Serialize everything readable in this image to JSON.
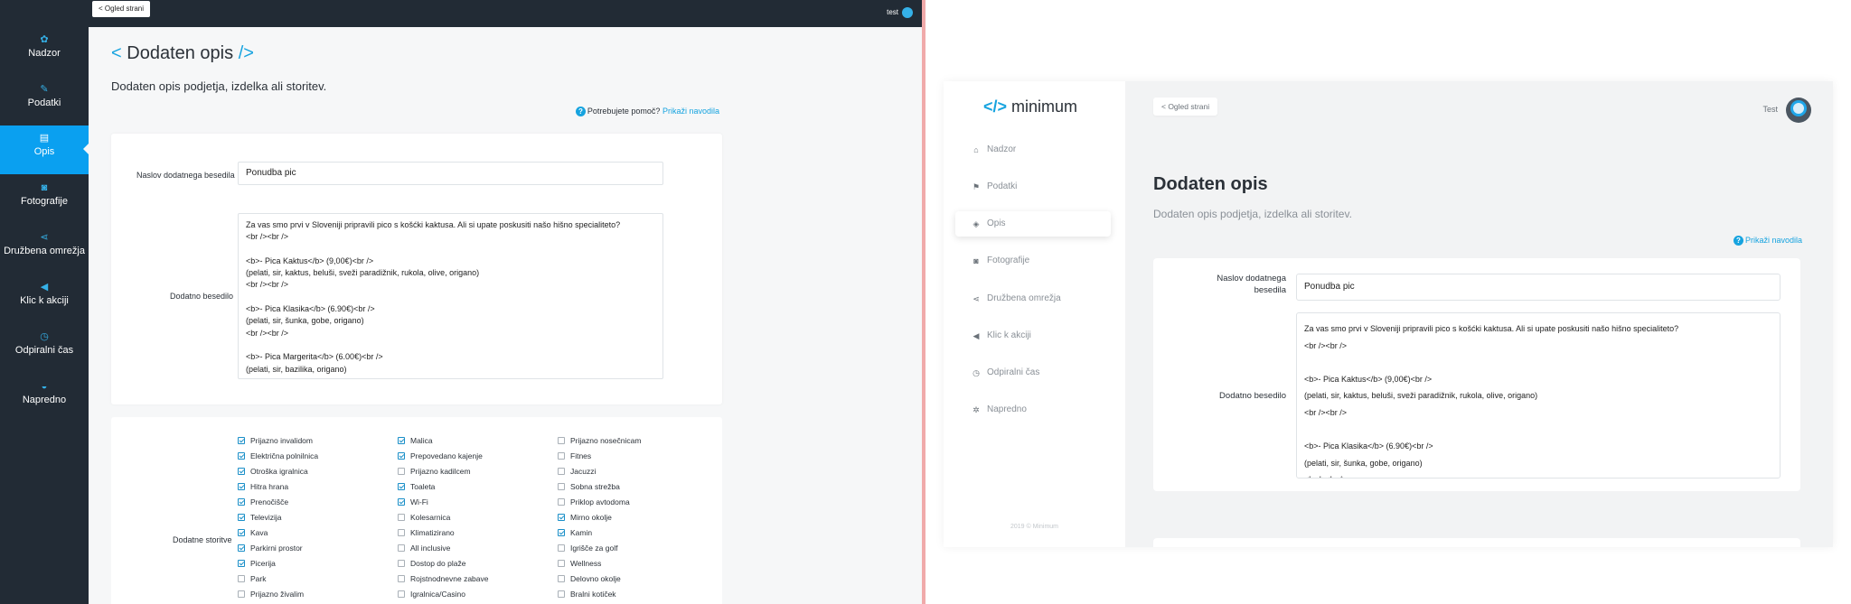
{
  "left": {
    "sidebar": [
      {
        "label": "Nadzor",
        "icon": "palette-icon",
        "glyph": "✿"
      },
      {
        "label": "Podatki",
        "icon": "document-icon",
        "glyph": "✎"
      },
      {
        "label": "Opis",
        "icon": "book-icon",
        "glyph": "▤",
        "active": true
      },
      {
        "label": "Fotografije",
        "icon": "camera-icon",
        "glyph": "◙"
      },
      {
        "label": "Družbena omrežja",
        "icon": "share-icon",
        "glyph": "⋖"
      },
      {
        "label": "Klic k akciji",
        "icon": "megaphone-icon",
        "glyph": "◀"
      },
      {
        "label": "Odpiralni čas",
        "icon": "clock-icon",
        "glyph": "◷"
      },
      {
        "label": "Napredno",
        "icon": "gauge-icon",
        "glyph": "◒"
      }
    ],
    "topbar": {
      "preview_label": "< Ogled strani",
      "user_name": "test"
    },
    "title_open": "<",
    "title": "Dodaten opis",
    "title_close": "/>",
    "subtitle": "Dodaten opis podjetja, izdelka ali storitev.",
    "help_text": "Potrebujete pomoč?",
    "help_link": "Prikaži navodila",
    "form": {
      "title_label": "Naslov dodatnega besedila",
      "title_value": "Ponudba pic",
      "text_label": "Dodatno besedilo",
      "text_value": "Za vas smo prvi v Sloveniji pripravili pico s košćki kaktusa. Ali si upate poskusiti našo hišno specialiteto?\n<br /><br />\n\n<b>- Pica Kaktus</b> (9,00€)<br />\n(pelati, sir, kaktus, beluši, sveži paradižnik, rukola, olive, origano)\n<br /><br />\n\n<b>- Pica Klasika</b> (6.90€)<br />\n(pelati, sir, šunka, gobe, origano)\n<br /><br />\n\n<b>- Pica Margerita</b> (6.00€)<br />\n(pelati, sir, bazilika, origano)"
    },
    "services_label": "Dodatne storitve",
    "services": [
      [
        {
          "label": "Prijazno invalidom",
          "checked": true
        },
        {
          "label": "Električna polnilnica",
          "checked": true
        },
        {
          "label": "Otroška igralnica",
          "checked": true
        },
        {
          "label": "Hitra hrana",
          "checked": true
        },
        {
          "label": "Prenočišče",
          "checked": true
        },
        {
          "label": "Televizija",
          "checked": true
        },
        {
          "label": "Kava",
          "checked": true
        },
        {
          "label": "Parkirni prostor",
          "checked": true
        },
        {
          "label": "Picerija",
          "checked": true
        },
        {
          "label": "Park",
          "checked": false
        },
        {
          "label": "Prijazno živalim",
          "checked": false
        }
      ],
      [
        {
          "label": "Malica",
          "checked": true
        },
        {
          "label": "Prepovedano kajenje",
          "checked": true
        },
        {
          "label": "Prijazno kadilcem",
          "checked": false
        },
        {
          "label": "Toaleta",
          "checked": true
        },
        {
          "label": "Wi-Fi",
          "checked": true
        },
        {
          "label": "Kolesarnica",
          "checked": false
        },
        {
          "label": "Klimatizirano",
          "checked": false
        },
        {
          "label": "All inclusive",
          "checked": false
        },
        {
          "label": "Dostop do plaže",
          "checked": false
        },
        {
          "label": "Rojstnodnevne zabave",
          "checked": false
        },
        {
          "label": "Igralnica/Casino",
          "checked": false
        }
      ],
      [
        {
          "label": "Prijazno nosečnicam",
          "checked": false
        },
        {
          "label": "Fitnes",
          "checked": false
        },
        {
          "label": "Jacuzzi",
          "checked": false
        },
        {
          "label": "Sobna strežba",
          "checked": false
        },
        {
          "label": "Priklop avtodoma",
          "checked": false
        },
        {
          "label": "Mirno okolje",
          "checked": true
        },
        {
          "label": "Kamin",
          "checked": true
        },
        {
          "label": "Igrišče za golf",
          "checked": false
        },
        {
          "label": "Wellness",
          "checked": false
        },
        {
          "label": "Delovno okolje",
          "checked": false
        },
        {
          "label": "Bralni kotiček",
          "checked": false
        }
      ]
    ]
  },
  "right": {
    "logo_text": "minimum",
    "sidebar": [
      {
        "label": "Nadzor",
        "icon": "home-icon",
        "glyph": "⌂"
      },
      {
        "label": "Podatki",
        "icon": "flag-icon",
        "glyph": "⚑"
      },
      {
        "label": "Opis",
        "icon": "tag-icon",
        "glyph": "◈",
        "active": true
      },
      {
        "label": "Fotografije",
        "icon": "camera-icon",
        "glyph": "◙"
      },
      {
        "label": "Družbena omrežja",
        "icon": "share-icon",
        "glyph": "⋖"
      },
      {
        "label": "Klic k akciji",
        "icon": "megaphone-icon",
        "glyph": "◀"
      },
      {
        "label": "Odpiralni čas",
        "icon": "clock-icon",
        "glyph": "◷"
      },
      {
        "label": "Napredno",
        "icon": "gear-icon",
        "glyph": "✲"
      }
    ],
    "copyright": "2019 © Minimum",
    "preview_label": "< Ogled strani",
    "user_name": "Test",
    "title": "Dodaten opis",
    "subtitle": "Dodaten opis podjetja, izdelka ali storitev.",
    "help_link": "Prikaži navodila",
    "form": {
      "title_label": "Naslov dodatnega besedila",
      "title_value": "Ponudba pic",
      "text_label": "Dodatno besedilo",
      "text_value": "Za vas smo prvi v Sloveniji pripravili pico s košćki kaktusa. Ali si upate poskusiti našo hišno specialiteto?\n<br /><br />\n\n<b>- Pica Kaktus</b> (9,00€)<br />\n(pelati, sir, kaktus, beluši, sveži paradižnik, rukola, olive, origano)\n<br /><br />\n\n<b>- Pica Klasika</b> (6.90€)<br />\n(pelati, sir, šunka, gobe, origano)\n<br /><br />"
    }
  },
  "colors": {
    "accent": "#0aa0f0",
    "dark_sidebar": "#222b35",
    "divider": "#f0aaaa"
  }
}
